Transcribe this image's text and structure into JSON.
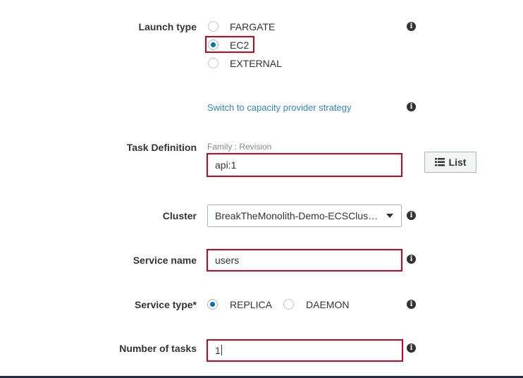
{
  "launch_type": {
    "label": "Launch type",
    "options": [
      {
        "label": "FARGATE",
        "checked": false
      },
      {
        "label": "EC2",
        "checked": true
      },
      {
        "label": "EXTERNAL",
        "checked": false
      }
    ]
  },
  "capacity_link": "Switch to capacity provider strategy",
  "task_definition": {
    "label": "Task Definition",
    "hint": "Family : Revision",
    "value": "api:1",
    "list_button": "List"
  },
  "cluster": {
    "label": "Cluster",
    "value": "BreakTheMonolith-Demo-ECSClus…"
  },
  "service_name": {
    "label": "Service name",
    "value": "users"
  },
  "service_type": {
    "label": "Service type*",
    "options": [
      {
        "label": "REPLICA",
        "checked": true
      },
      {
        "label": "DAEMON",
        "checked": false
      }
    ]
  },
  "number_of_tasks": {
    "label": "Number of tasks",
    "value": "1"
  },
  "colors": {
    "accent": "#0073bb",
    "link": "#2e87cf",
    "highlight": "#d0021b"
  },
  "icons": {
    "info": "info-icon",
    "list": "list-icon"
  }
}
